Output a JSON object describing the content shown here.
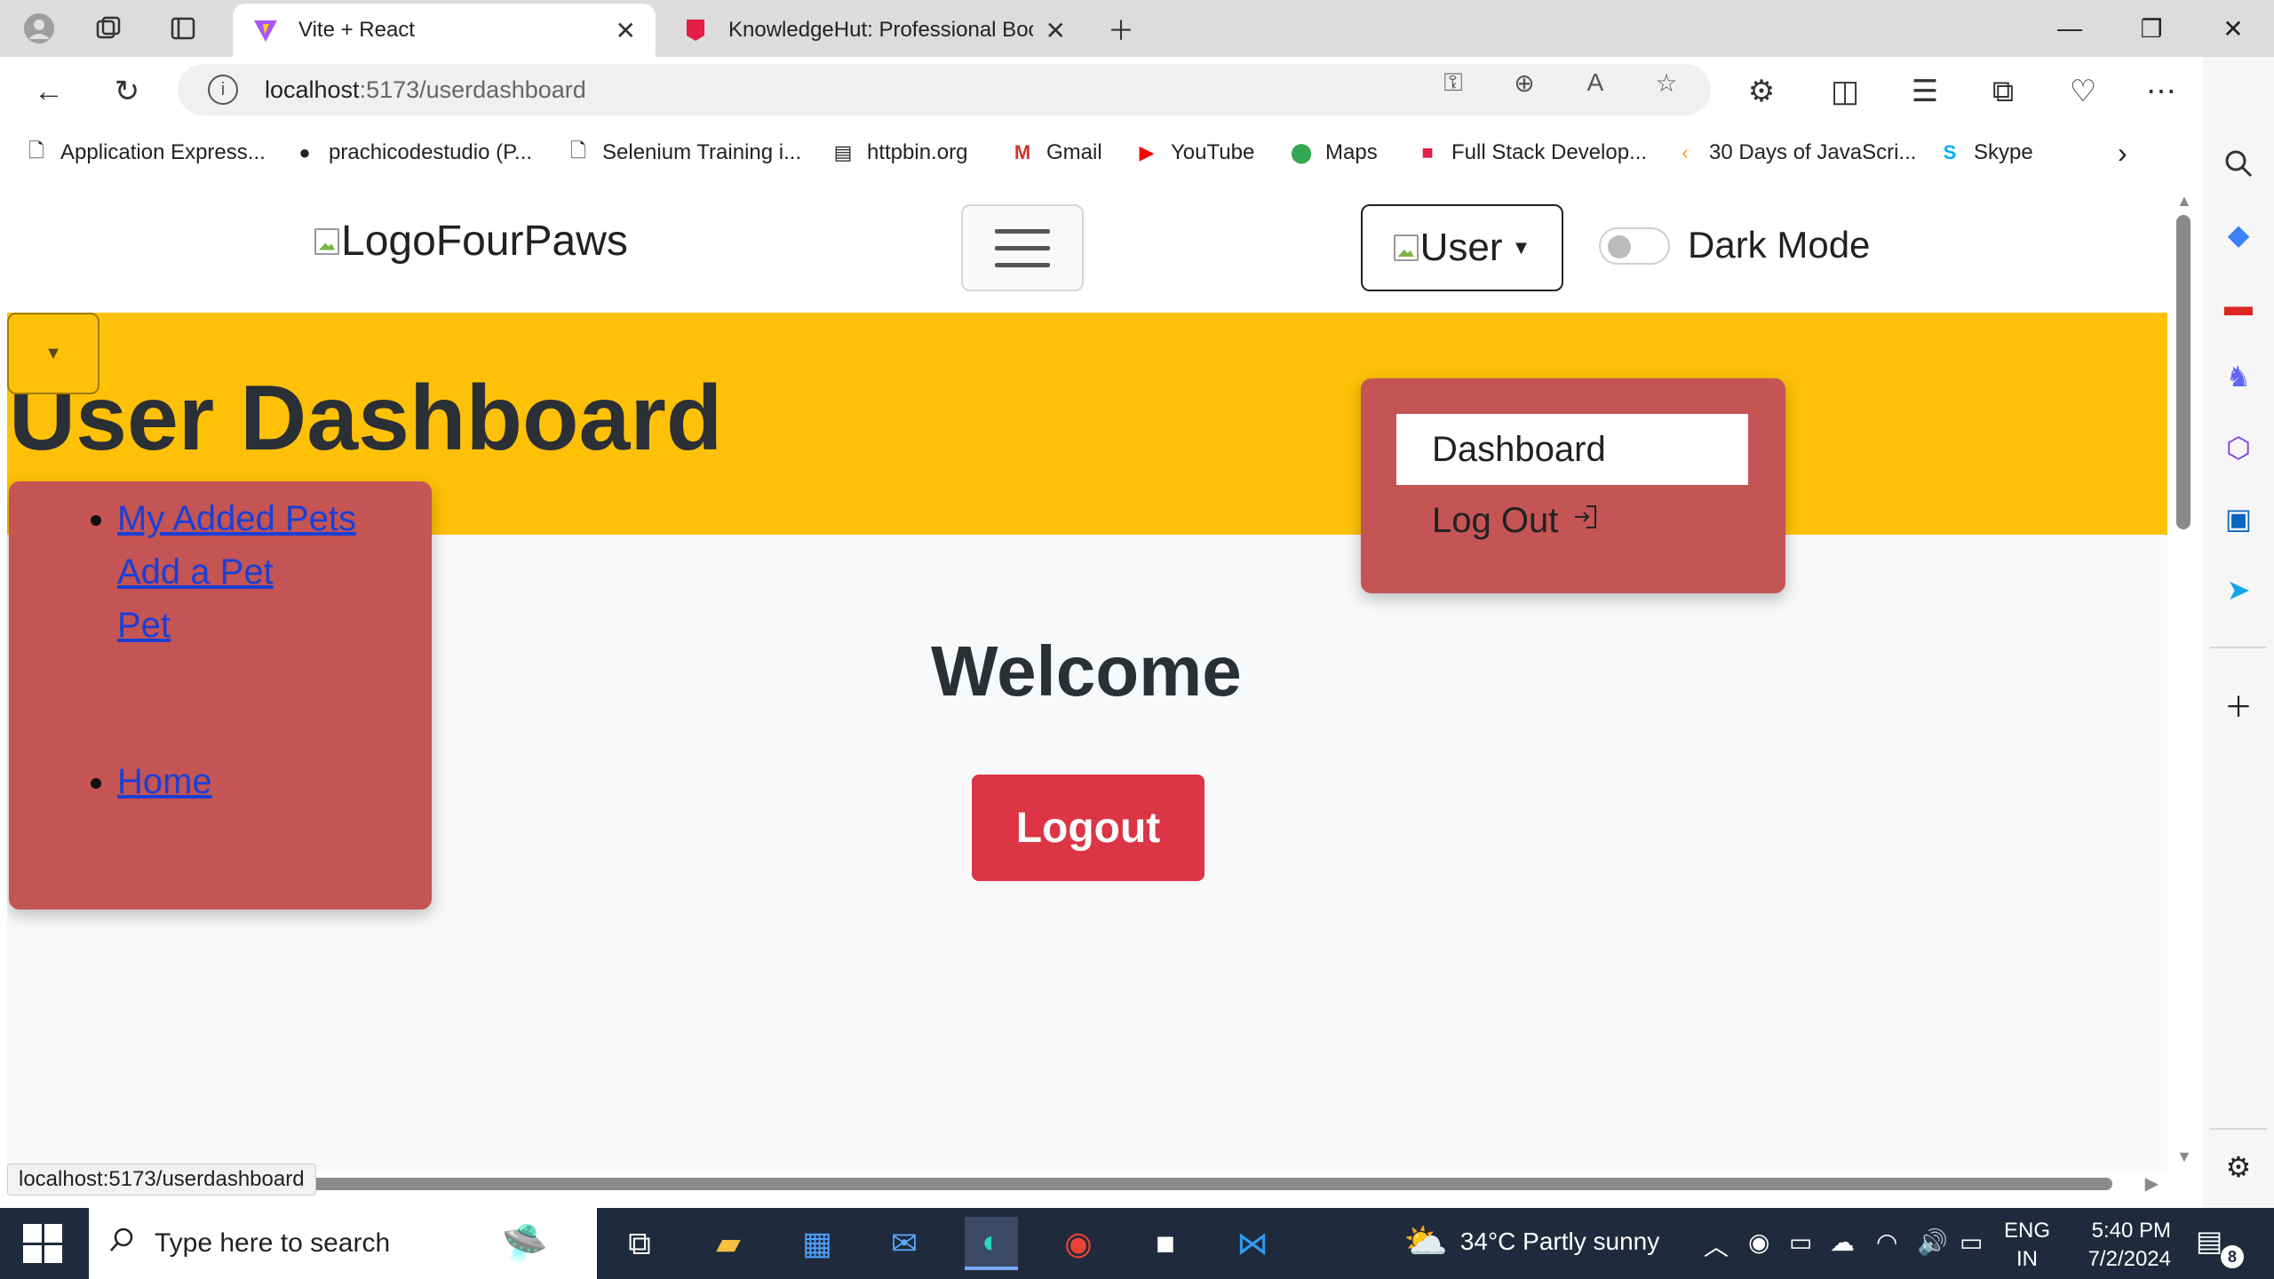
{
  "browser": {
    "tabs": [
      {
        "title": "Vite + React",
        "active": true
      },
      {
        "title": "KnowledgeHut: Professional Boo",
        "active": false
      }
    ],
    "address": {
      "host": "localhost",
      "path": ":5173/userdashboard"
    },
    "bookmarks": [
      {
        "label": "Application Express...",
        "icon": "file-icon"
      },
      {
        "label": "prachicodestudio (P...",
        "icon": "github-icon"
      },
      {
        "label": "Selenium Training i...",
        "icon": "file-icon"
      },
      {
        "label": "httpbin.org",
        "icon": "httpbin-icon"
      },
      {
        "label": "Gmail",
        "icon": "gmail-icon"
      },
      {
        "label": "YouTube",
        "icon": "youtube-icon"
      },
      {
        "label": "Maps",
        "icon": "maps-icon"
      },
      {
        "label": "Full Stack Develop...",
        "icon": "knowledgehut-icon"
      },
      {
        "label": "30 Days of JavaScri...",
        "icon": "js-icon"
      },
      {
        "label": "Skype",
        "icon": "skype-icon"
      }
    ],
    "status_url": "localhost:5173/userdashboard"
  },
  "page": {
    "logo_text": "LogoFourPaws",
    "user_button": "User",
    "dark_mode_label": "Dark Mode",
    "title": "User Dashboard",
    "sidebar": {
      "links": [
        "My Added Pets",
        "Add a Pet",
        "Pet"
      ],
      "home": "Home"
    },
    "user_menu": {
      "items": [
        "Dashboard",
        "Log Out"
      ]
    },
    "welcome": "Welcome",
    "logout_button": "Logout"
  },
  "taskbar": {
    "search_placeholder": "Type here to search",
    "weather": "34°C  Partly sunny",
    "lang": [
      "ENG",
      "IN"
    ],
    "time": "5:40 PM",
    "date": "7/2/2024",
    "notifications": "8"
  },
  "colors": {
    "banner": "#ffc107",
    "sidebar": "#c55454",
    "logout": "#dc3545",
    "link": "#1a3fd6"
  }
}
